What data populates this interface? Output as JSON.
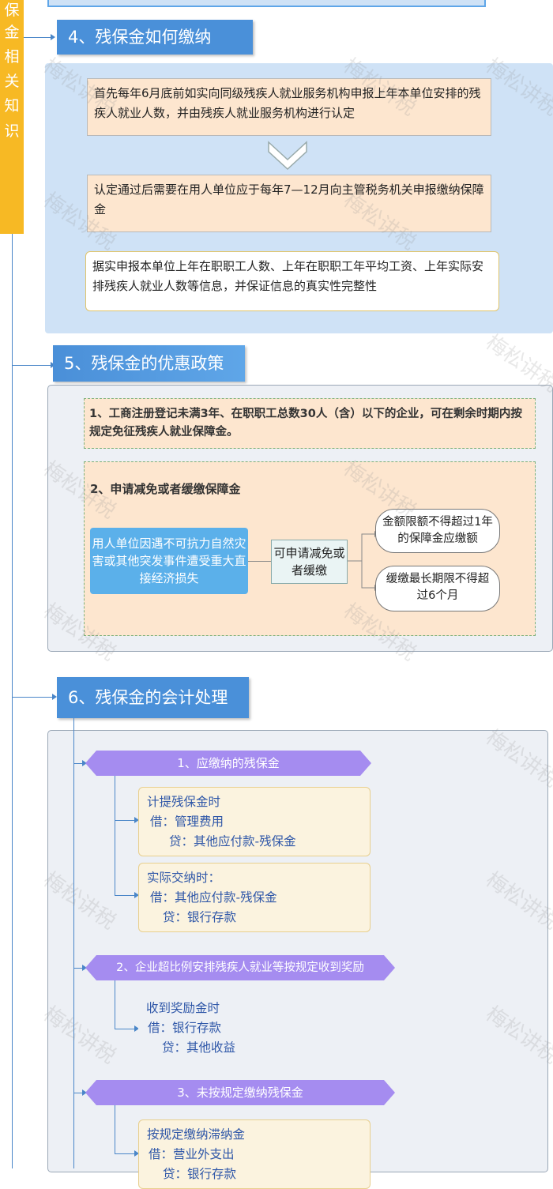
{
  "sidebar": {
    "label_chars": [
      "保",
      "金",
      "相",
      "关",
      "知",
      "识"
    ]
  },
  "watermark": "梅松讲税",
  "sections": {
    "s4": {
      "title": "4、残保金如何缴纳",
      "step1": "首先每年6月底前如实向同级残疾人就业服务机构申报上年本单位安排的残疾人就业人数，并由残疾人就业服务机构进行认定",
      "step2": "认定通过后需要在用人单位应于每年7—12月向主管税务机关申报缴纳保障金",
      "step3": "据实申报本单位上年在职职工人数、上年在职职工年平均工资、上年实际安排残疾人就业人数等信息，并保证信息的真实性完整性"
    },
    "s5": {
      "title": "5、残保金的优惠政策",
      "policy1": "1、工商注册登记未满3年、在职职工总数30人（含）以下的企业，可在剩余时期内按规定免征残疾人就业保障金。",
      "policy2_title": "2、申请减免或者缓缴保障金",
      "cause": "用人单位因遇不可抗力自然灾害或其他突发事件遭受重大直接经济损失",
      "action": "可申请减免或者缓缴",
      "result1": "金额限额不得超过1年的保障金应缴额",
      "result2": "缓缴最长期限不得超过6个月"
    },
    "s6": {
      "title": "6、残保金的会计处理",
      "cat1": "1、应缴纳的残保金",
      "e1": {
        "l1": "计提残保金时",
        "l2": "借：管理费用",
        "l3": "贷：其他应付款-残保金"
      },
      "e2": {
        "l1": "实际交纳时：",
        "l2": "借：其他应付款-残保金",
        "l3": "贷：银行存款"
      },
      "cat2": "2、企业超比例安排残疾人就业等按规定收到奖励",
      "e3": {
        "l1": "收到奖励金时",
        "l2": "借：银行存款",
        "l3": "贷：其他收益"
      },
      "cat3": "3、未按规定缴纳残保金",
      "e4": {
        "l1": "按规定缴纳滞纳金",
        "l2": "借：营业外支出",
        "l3": "贷：银行存款"
      }
    }
  }
}
